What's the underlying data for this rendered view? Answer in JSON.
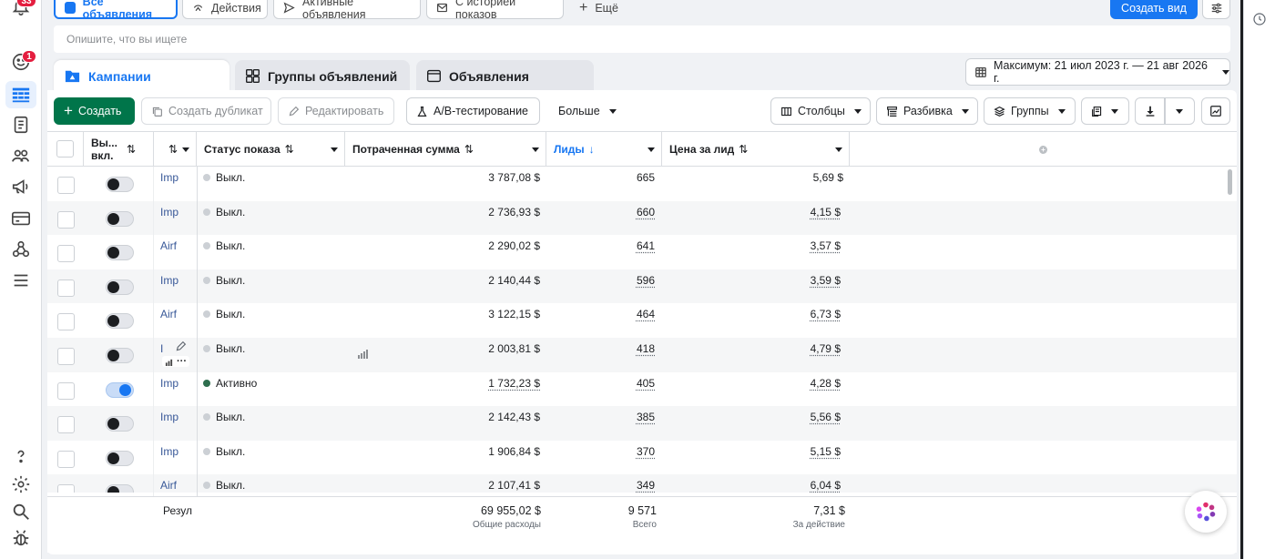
{
  "notifications": {
    "count": "33",
    "unread_badge": "1"
  },
  "view_tabs": [
    {
      "label": "Все объявления"
    },
    {
      "label": "Действия"
    },
    {
      "label": "Активные объявления"
    },
    {
      "label": "С историей показов"
    },
    {
      "label": "Ещё"
    }
  ],
  "create_view_label": "Создать вид",
  "search": {
    "placeholder": "Опишите, что вы ищете"
  },
  "level_tabs": [
    {
      "label": "Кампании"
    },
    {
      "label": "Группы объявлений"
    },
    {
      "label": "Объявления"
    }
  ],
  "date_range": "Максимум: 21 июл 2023 г. — 21 авг 2026 г.",
  "toolbar": {
    "create": "Создать",
    "duplicate": "Создать дубликат",
    "edit": "Редактировать",
    "ab_test": "A/B-тестирование",
    "more": "Больше",
    "columns": "Столбцы",
    "breakdown": "Разбивка",
    "groups": "Группы"
  },
  "columns": {
    "onoff": "Вы... вкл.",
    "status": "Статус показа",
    "spent": "Потраченная сумма",
    "leads": "Лиды",
    "cpl": "Цена за лид"
  },
  "rows": [
    {
      "name": "Imp",
      "on": false,
      "status": "Выкл.",
      "spent": "3 787,08 $",
      "leads": "665",
      "cpl": "5,69 $"
    },
    {
      "name": "Imp",
      "on": false,
      "status": "Выкл.",
      "spent": "2 736,93 $",
      "leads": "660",
      "cpl": "4,15 $"
    },
    {
      "name": "Airf",
      "on": false,
      "status": "Выкл.",
      "spent": "2 290,02 $",
      "leads": "641",
      "cpl": "3,57 $"
    },
    {
      "name": "Imp",
      "on": false,
      "status": "Выкл.",
      "spent": "2 140,44 $",
      "leads": "596",
      "cpl": "3,59 $"
    },
    {
      "name": "Airf",
      "on": false,
      "status": "Выкл.",
      "spent": "3 122,15 $",
      "leads": "464",
      "cpl": "6,73 $"
    },
    {
      "name": "I",
      "on": false,
      "status": "Выкл.",
      "spent": "2 003,81 $",
      "leads": "418",
      "cpl": "4,79 $"
    },
    {
      "name": "Imp",
      "on": true,
      "status": "Активно",
      "spent": "1 732,23 $",
      "leads": "405",
      "cpl": "4,28 $"
    },
    {
      "name": "Imp",
      "on": false,
      "status": "Выкл.",
      "spent": "2 142,43 $",
      "leads": "385",
      "cpl": "5,56 $"
    },
    {
      "name": "Imp",
      "on": false,
      "status": "Выкл.",
      "spent": "1 906,84 $",
      "leads": "370",
      "cpl": "5,15 $"
    },
    {
      "name": "Airf",
      "on": false,
      "status": "Выкл.",
      "spent": "2 107,41 $",
      "leads": "349",
      "cpl": "6,04 $"
    }
  ],
  "totals": {
    "label": "Резул",
    "spent": "69 955,02 $",
    "spent_sub": "Общие расходы",
    "leads": "9 571",
    "leads_sub": "Всего",
    "cpl": "7,31 $",
    "cpl_sub": "За действие"
  },
  "colors": {
    "accent": "#1877f2",
    "create_green": "#00754a",
    "active_dot": "#2e6e4e"
  }
}
